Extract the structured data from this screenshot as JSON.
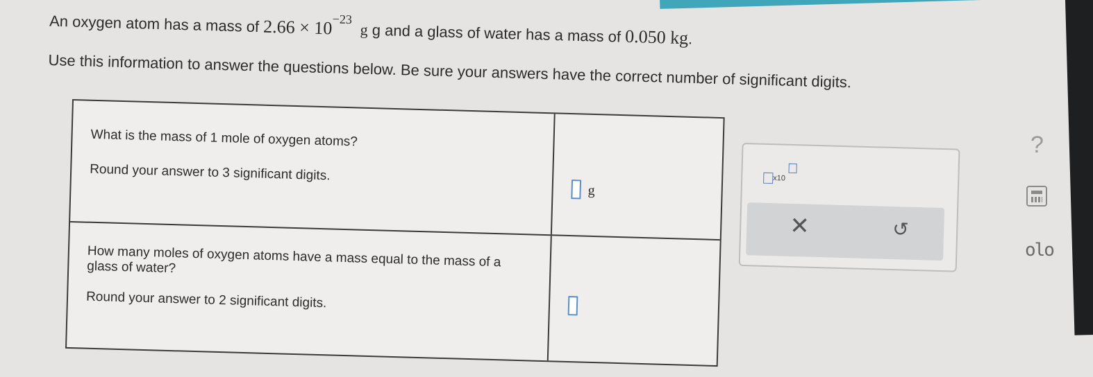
{
  "problem": {
    "line1_prefix": "An oxygen atom has a mass of",
    "atom_mass_mantissa": "2.66",
    "times": "×",
    "base": "10",
    "exponent": "−23",
    "line1_mid": "g and a glass of water has a mass of",
    "water_mass": "0.050 kg",
    "line1_end": ".",
    "line2": "Use this information to answer the questions below. Be sure your answers have the correct number of significant digits."
  },
  "questions": [
    {
      "question": "What is the mass of 1 mole of oxygen atoms?",
      "instruction": "Round your answer to 3 significant digits.",
      "unit": "g"
    },
    {
      "question": "How many moles of oxygen atoms have a mass equal to the mass of a glass of water?",
      "instruction": "Round your answer to 2 significant digits.",
      "unit": ""
    }
  ],
  "toolbar": {
    "x10_label": "x10",
    "clear_symbol": "✕",
    "undo_symbol": "↺"
  },
  "side_tools": {
    "help_symbol": "?",
    "chart_symbol": "olo"
  }
}
